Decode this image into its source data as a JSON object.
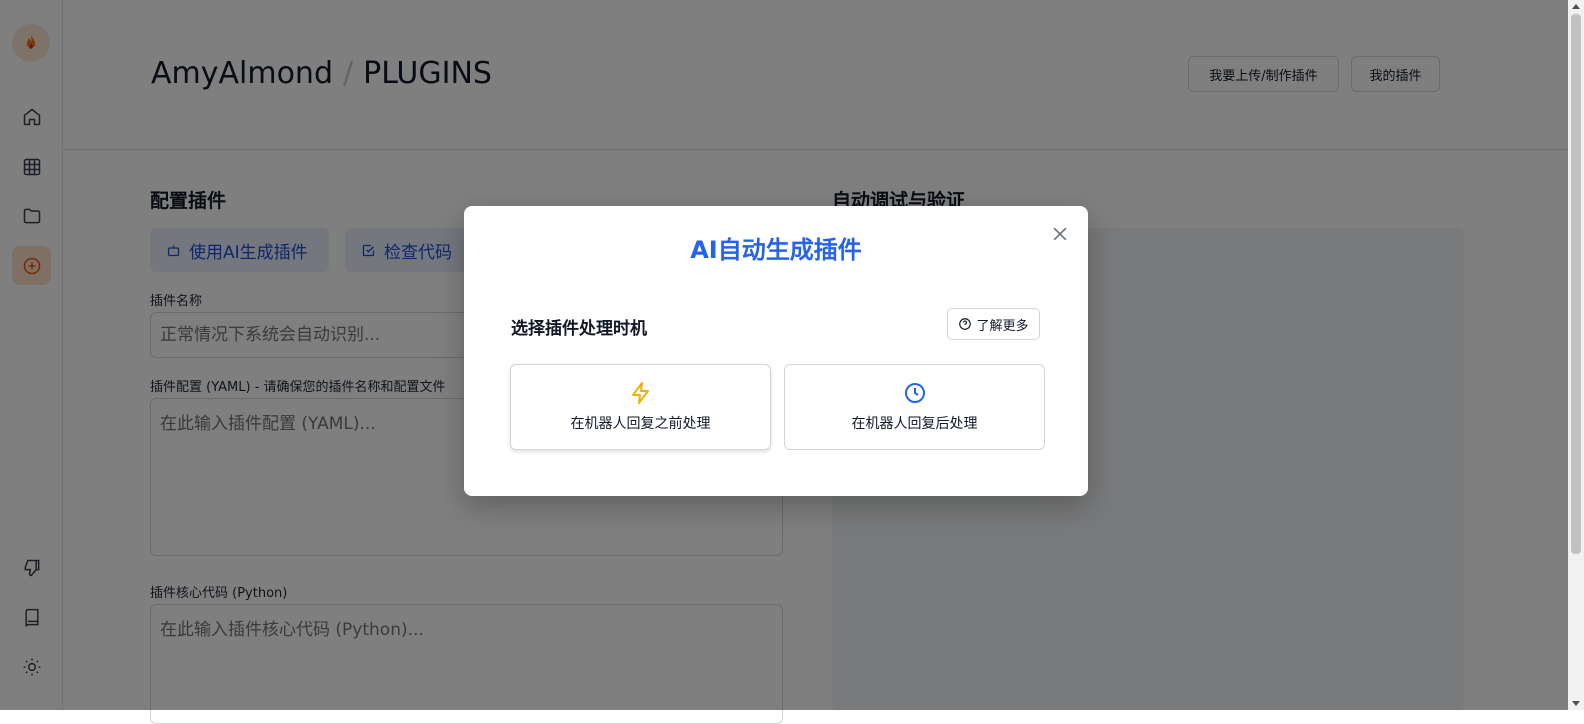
{
  "header": {
    "user": "AmyAlmond",
    "separator": "/",
    "page": "PLUGINS",
    "upload_button": "我要上传/制作插件",
    "my_plugins_button": "我的插件"
  },
  "sidebar": {
    "items": [
      {
        "icon": "home-icon"
      },
      {
        "icon": "grid-icon"
      },
      {
        "icon": "folder-icon"
      },
      {
        "icon": "plus-circle-icon",
        "active": true
      },
      {
        "icon": "thumbs-down-icon"
      },
      {
        "icon": "book-icon"
      },
      {
        "icon": "sun-icon"
      }
    ]
  },
  "config": {
    "title": "配置插件",
    "ai_generate_button": "使用AI生成插件",
    "check_code_button": "检查代码",
    "name_label": "插件名称",
    "name_placeholder": "正常情况下系统会自动识别...",
    "yaml_label": "插件配置 (YAML) - 请确保您的插件名称和配置文件",
    "yaml_placeholder": "在此输入插件配置 (YAML)...",
    "code_label": "插件核心代码 (Python)",
    "code_placeholder": "在此输入插件核心代码 (Python)..."
  },
  "debug": {
    "title": "自动调试与验证"
  },
  "modal": {
    "title": "AI自动生成插件",
    "subtitle": "选择插件处理时机",
    "learn_more": "了解更多",
    "option_before": "在机器人回复之前处理",
    "option_after": "在机器人回复后处理"
  },
  "colors": {
    "accent": "#2563eb",
    "active_sidebar": "#fde0c8",
    "lightning": "#eab308",
    "clock": "#2563eb"
  }
}
